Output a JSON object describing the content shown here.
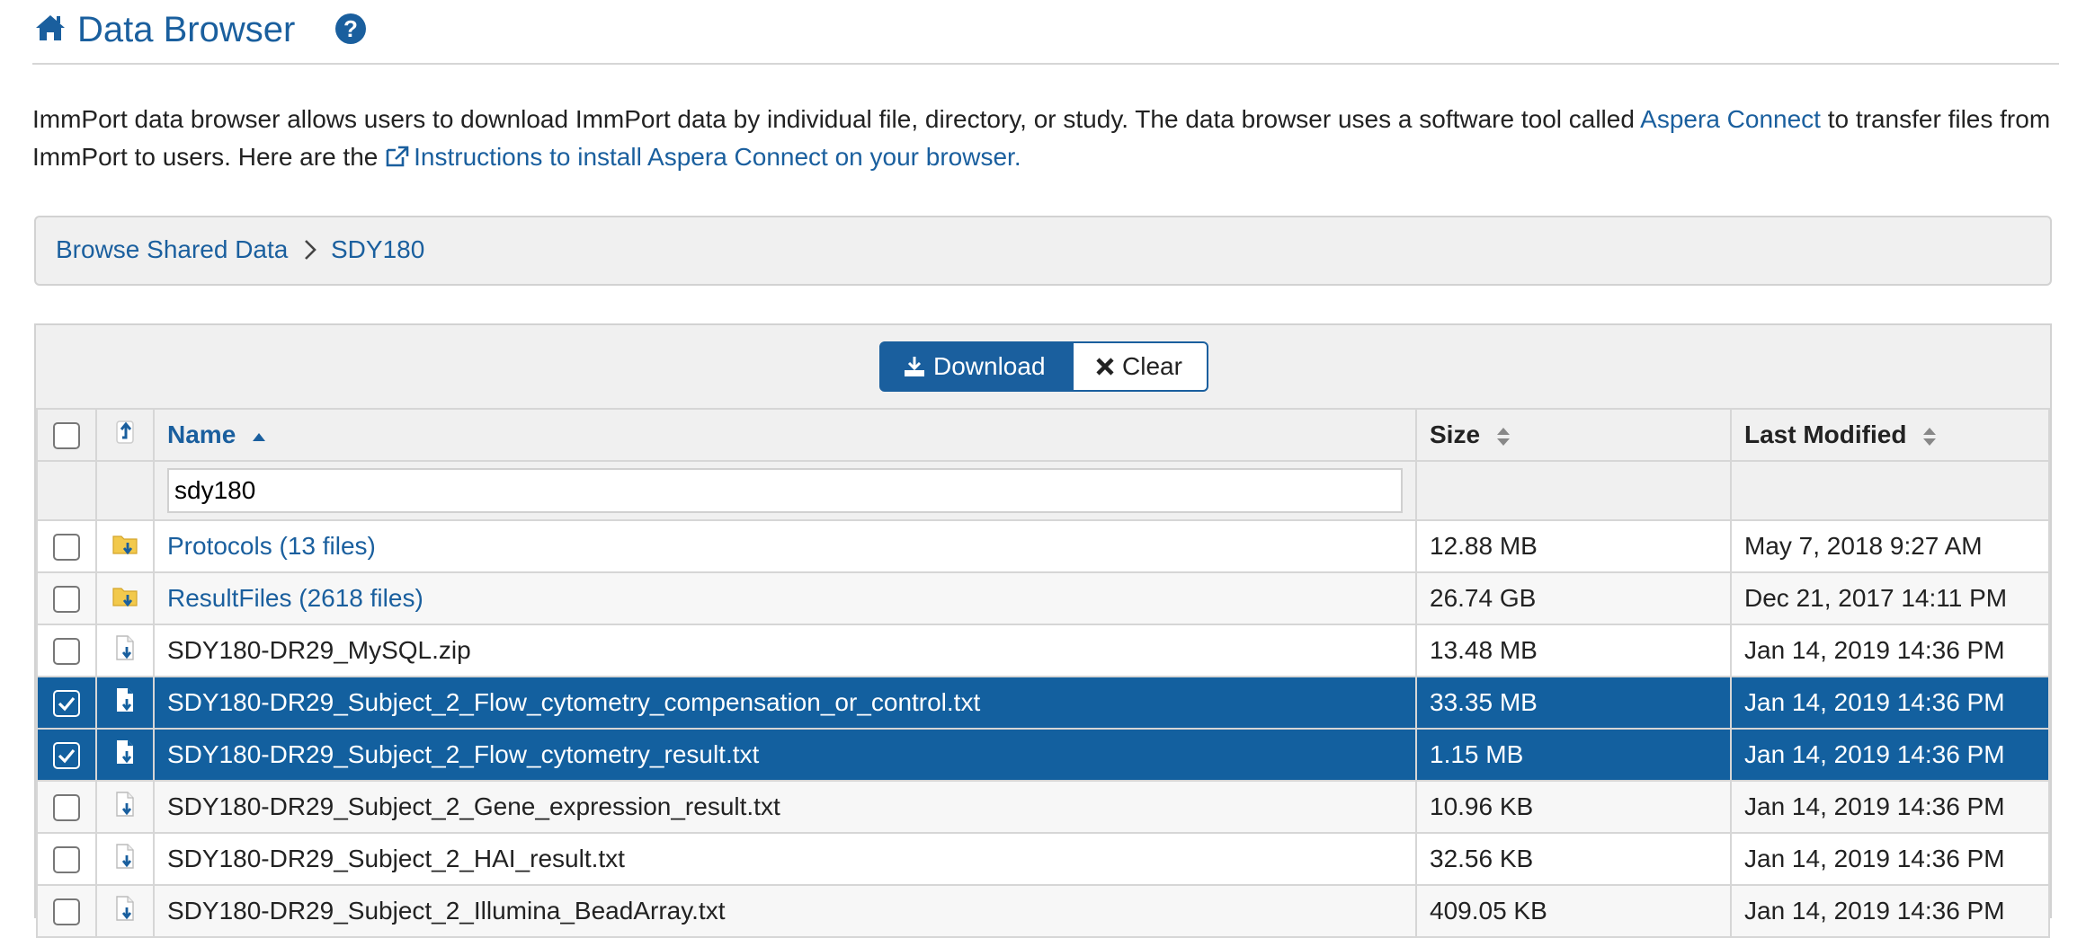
{
  "header": {
    "title": "Data Browser"
  },
  "intro": {
    "text_1": "ImmPort data browser allows users to download ImmPort data by individual file, directory, or study. The data browser uses a software tool called ",
    "aspera_link": "Aspera Connect",
    "text_2": " to transfer files from ImmPort to users. Here are the ",
    "instructions_link": "Instructions to install Aspera Connect on your browser."
  },
  "breadcrumb": {
    "root": "Browse Shared Data",
    "current": "SDY180"
  },
  "toolbar": {
    "download_label": "Download",
    "clear_label": "Clear"
  },
  "table": {
    "columns": {
      "name": "Name",
      "size": "Size",
      "modified": "Last Modified"
    },
    "filter_value": "sdy180",
    "rows": [
      {
        "name": "Protocols (13 files)",
        "size": "12.88 MB",
        "modified": "May 7, 2018 9:27 AM",
        "type": "folder",
        "selected": false
      },
      {
        "name": "ResultFiles (2618 files)",
        "size": "26.74 GB",
        "modified": "Dec 21, 2017 14:11 PM",
        "type": "folder",
        "selected": false
      },
      {
        "name": "SDY180-DR29_MySQL.zip",
        "size": "13.48 MB",
        "modified": "Jan 14, 2019 14:36 PM",
        "type": "file",
        "selected": false
      },
      {
        "name": "SDY180-DR29_Subject_2_Flow_cytometry_compensation_or_control.txt",
        "size": "33.35 MB",
        "modified": "Jan 14, 2019 14:36 PM",
        "type": "file",
        "selected": true
      },
      {
        "name": "SDY180-DR29_Subject_2_Flow_cytometry_result.txt",
        "size": "1.15 MB",
        "modified": "Jan 14, 2019 14:36 PM",
        "type": "file",
        "selected": true
      },
      {
        "name": "SDY180-DR29_Subject_2_Gene_expression_result.txt",
        "size": "10.96 KB",
        "modified": "Jan 14, 2019 14:36 PM",
        "type": "file",
        "selected": false
      },
      {
        "name": "SDY180-DR29_Subject_2_HAI_result.txt",
        "size": "32.56 KB",
        "modified": "Jan 14, 2019 14:36 PM",
        "type": "file",
        "selected": false
      },
      {
        "name": "SDY180-DR29_Subject_2_Illumina_BeadArray.txt",
        "size": "409.05 KB",
        "modified": "Jan 14, 2019 14:36 PM",
        "type": "file",
        "selected": false
      }
    ]
  },
  "colors": {
    "brand_blue": "#1a5f9e",
    "selected_row": "#13609f",
    "panel_bg": "#f0f0f0"
  },
  "icons": [
    "home-icon",
    "help-icon",
    "external-link-icon",
    "chevron-right-icon",
    "download-icon",
    "times-icon",
    "level-up-icon",
    "sort-asc-icon",
    "sort-icon",
    "folder-download-icon",
    "file-download-icon",
    "check-icon"
  ]
}
